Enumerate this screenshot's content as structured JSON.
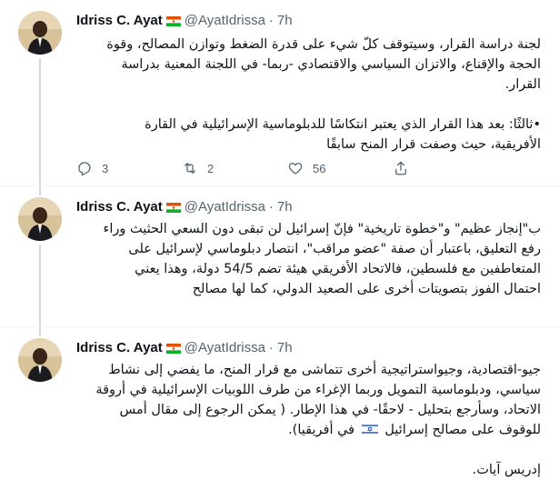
{
  "tweets": [
    {
      "author": {
        "name": "Idriss C. Ayat",
        "handle": "@AyatIdrissa",
        "time": "7h"
      },
      "lines": [
        "لجنة دراسة القرار، وسيتوقف كلّ شيء على قدرة الضغط وتوازن المصالح، وقوة",
        "الحجة والإقناع، والاتزان السياسي والاقتصادي -ربما- في اللجنة المعنية بدراسة",
        "القرار."
      ],
      "lines2": [
        "•ثالثًا: بعد هذا القرار الذي يعتبر انتكاسًا للدبلوماسية الإسرائيلية في القارة",
        "الأفريقية، حيث وصفت قرار المنح سابقًا"
      ],
      "stats": {
        "replies": "3",
        "retweets": "2",
        "likes": "56"
      }
    },
    {
      "author": {
        "name": "Idriss C. Ayat",
        "handle": "@AyatIdrissa",
        "time": "7h"
      },
      "lines": [
        "ب\"إنجاز عظيم\" و\"خطوة تاريخية\" فإنّ إسرائيل لن تبقى دون السعي الحثيث وراء",
        "رفع التعليق، باعتبار أن صفة \"عضو مراقب\"، انتصار دبلوماسي لإسرائيل على",
        "المتعاطفين مع فلسطين، فالاتحاد الأفريقي هيئة تضم 54/5 دولة، وهذا يعني",
        "احتمال الفوز بتصويتات أخرى على الصعيد الدولي، كما لها مصالح"
      ]
    },
    {
      "author": {
        "name": "Idriss C. Ayat",
        "handle": "@AyatIdrissa",
        "time": "7h"
      },
      "lines": [
        "جيو-اقتصادية، وجيواستراتيجية أخرى تتماشى مع قرار المنح، ما يفضي إلى نشاط",
        "سياسي، ودبلوماسية التمويل وربما الإغراء من طرف اللوبيات الإسرائيلية في أروقة",
        "الاتحاد، وسأرجع بتحليل - لاحقًا- في هذا الإطار. ( يمكن الرجوع إلى مقال أمس"
      ],
      "last_line_before": "للوقوف على مصالح إسرائيل",
      "last_line_after": "في أفريقيا).",
      "signature": "إدريس آيات."
    }
  ],
  "colors": {
    "text": "#0f1419",
    "secondary": "#536471",
    "divider": "#eff3f4",
    "thread": "#cfd9de"
  },
  "icons": {
    "reply": "reply-icon",
    "retweet": "retweet-icon",
    "like": "heart-icon",
    "share": "share-icon",
    "niger_flag": "niger-flag-icon",
    "israel_flag": "israel-flag-icon"
  }
}
